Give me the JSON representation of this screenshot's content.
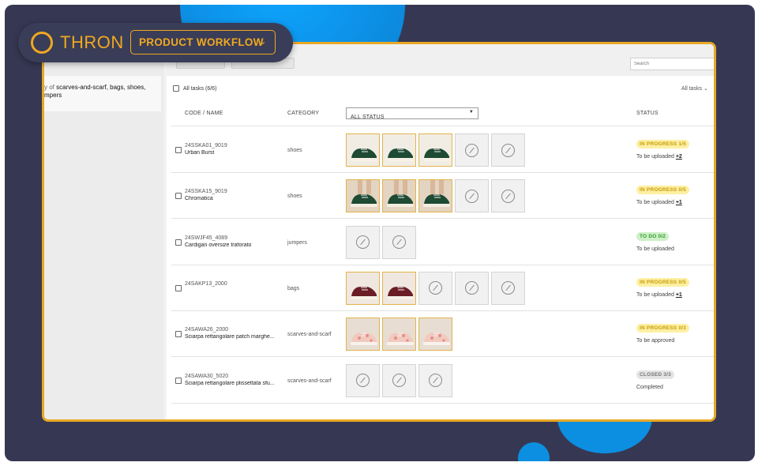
{
  "brand": {
    "logo_text": "THRON",
    "workflow_label": "PRODUCT WORKFLOW",
    "accent": "#f0a821"
  },
  "sidebar": {
    "filter_prefix": "y of",
    "filter_values_1": "scarves-and-scarf, bags, shoes,",
    "filter_values_2": "mpers"
  },
  "search": {
    "placeholder": "Search"
  },
  "list": {
    "all_tasks_label": "All tasks (6/6)",
    "filter_right": "All tasks"
  },
  "columns": {
    "code_name": "CODE / NAME",
    "category": "CATEGORY",
    "status_filter": "ALL STATUS",
    "status": "STATUS"
  },
  "rows": [
    {
      "code": "24SSKA01_9019",
      "name": "Urban Burst",
      "category": "shoes",
      "status": "IN PROGRESS 1/5",
      "status_type": "progress",
      "sub": "To be uploaded",
      "more": "+2",
      "thumbs": [
        "green",
        "green",
        "green",
        "empty",
        "empty"
      ]
    },
    {
      "code": "24SSKA15_9019",
      "name": "Chromatica",
      "category": "shoes",
      "status": "IN PROGRESS 0/5",
      "status_type": "progress",
      "sub": "To be uploaded",
      "more": "+1",
      "thumbs": [
        "greenlegs",
        "greenlegs",
        "greenlegs",
        "empty",
        "empty"
      ]
    },
    {
      "code": "24SWJF45_4089",
      "name": "Cardigan oversize traforato",
      "category": "jumpers",
      "status": "TO DO 0/2",
      "status_type": "todo",
      "sub": "To be uploaded",
      "more": "",
      "thumbs": [
        "empty",
        "empty"
      ]
    },
    {
      "code": "24SAKP13_2000",
      "name": "",
      "category": "bags",
      "status": "IN PROGRESS 0/5",
      "status_type": "progress",
      "sub": "To be uploaded",
      "more": "+1",
      "thumbs": [
        "red",
        "red",
        "empty",
        "empty",
        "empty"
      ]
    },
    {
      "code": "24SAWA26_2000",
      "name": "Sciarpa rettangolare patch marghe...",
      "category": "scarves-and-scarf",
      "status": "IN PROGRESS 0/3",
      "status_type": "progress",
      "sub": "To be approved",
      "more": "",
      "thumbs": [
        "pink",
        "pink",
        "pink"
      ]
    },
    {
      "code": "24SAWA30_5020",
      "name": "Sciarpa rettangolare plissettata sfu...",
      "category": "scarves-and-scarf",
      "status": "CLOSED 3/3",
      "status_type": "closed",
      "sub": "Completed",
      "more": "",
      "thumbs": [
        "empty",
        "empty",
        "empty"
      ]
    }
  ]
}
